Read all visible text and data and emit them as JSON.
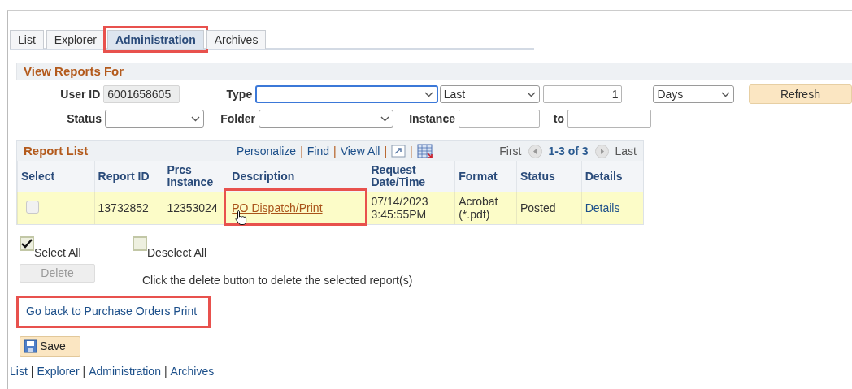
{
  "tabs": [
    {
      "label": "List",
      "selected": false,
      "highlighted": false
    },
    {
      "label": "Explorer",
      "selected": false,
      "highlighted": false
    },
    {
      "label": "Administration",
      "selected": true,
      "highlighted": true
    },
    {
      "label": "Archives",
      "selected": false,
      "highlighted": false
    }
  ],
  "view_reports_for": {
    "title": "View Reports For",
    "user_id": {
      "label": "User ID",
      "value": "6001658605"
    },
    "type": {
      "label": "Type",
      "focused": true
    },
    "range": {
      "value": "Last"
    },
    "count": {
      "value": "1"
    },
    "unit": {
      "value": "Days"
    },
    "refresh_button": "Refresh",
    "status": {
      "label": "Status"
    },
    "folder": {
      "label": "Folder"
    },
    "instance": {
      "label": "Instance"
    },
    "to": {
      "label": "to"
    }
  },
  "report_list": {
    "title": "Report List",
    "toolbar": [
      {
        "kind": "link",
        "text": "Personalize"
      },
      {
        "kind": "separator",
        "text": "|"
      },
      {
        "kind": "link",
        "text": "Find"
      },
      {
        "kind": "separator",
        "text": "|"
      },
      {
        "kind": "link",
        "text": "View All"
      },
      {
        "kind": "separator",
        "text": "|"
      },
      {
        "kind": "zoom"
      },
      {
        "kind": "separator",
        "text": "|"
      },
      {
        "kind": "download"
      }
    ],
    "pager": {
      "first": "First",
      "range": "1-3 of 3",
      "last": "Last"
    },
    "columns": [
      "Select",
      "Report ID",
      "Prcs Instance",
      "Description",
      "Request Date/Time",
      "Format",
      "Status",
      "Details"
    ],
    "rows": [
      {
        "checked": false,
        "report_id": "13732852",
        "prcs_instance": "12353024",
        "description": "PO Dispatch/Print",
        "description_highlighted": true,
        "request_date_time": "07/14/2023 3:45:55PM",
        "format": "Acrobat (*.pdf)",
        "status": "Posted",
        "details": "Details"
      }
    ]
  },
  "select_all": {
    "label": "Select All",
    "checked": true
  },
  "deselect_all": {
    "label": "Deselect All",
    "checked": false
  },
  "delete_button": {
    "label": "Delete",
    "disabled": true
  },
  "delete_hint": "Click the delete button to delete the selected report(s)",
  "back_link": {
    "text": "Go back to Purchase Orders Print",
    "highlighted": true
  },
  "save_button": "Save",
  "footer": [
    {
      "kind": "link",
      "text": "List"
    },
    {
      "kind": "separator",
      "text": "|"
    },
    {
      "kind": "link",
      "text": "Explorer"
    },
    {
      "kind": "separator",
      "text": "|"
    },
    {
      "kind": "link",
      "text": "Administration"
    },
    {
      "kind": "separator",
      "text": "|"
    },
    {
      "kind": "link",
      "text": "Archives"
    }
  ]
}
